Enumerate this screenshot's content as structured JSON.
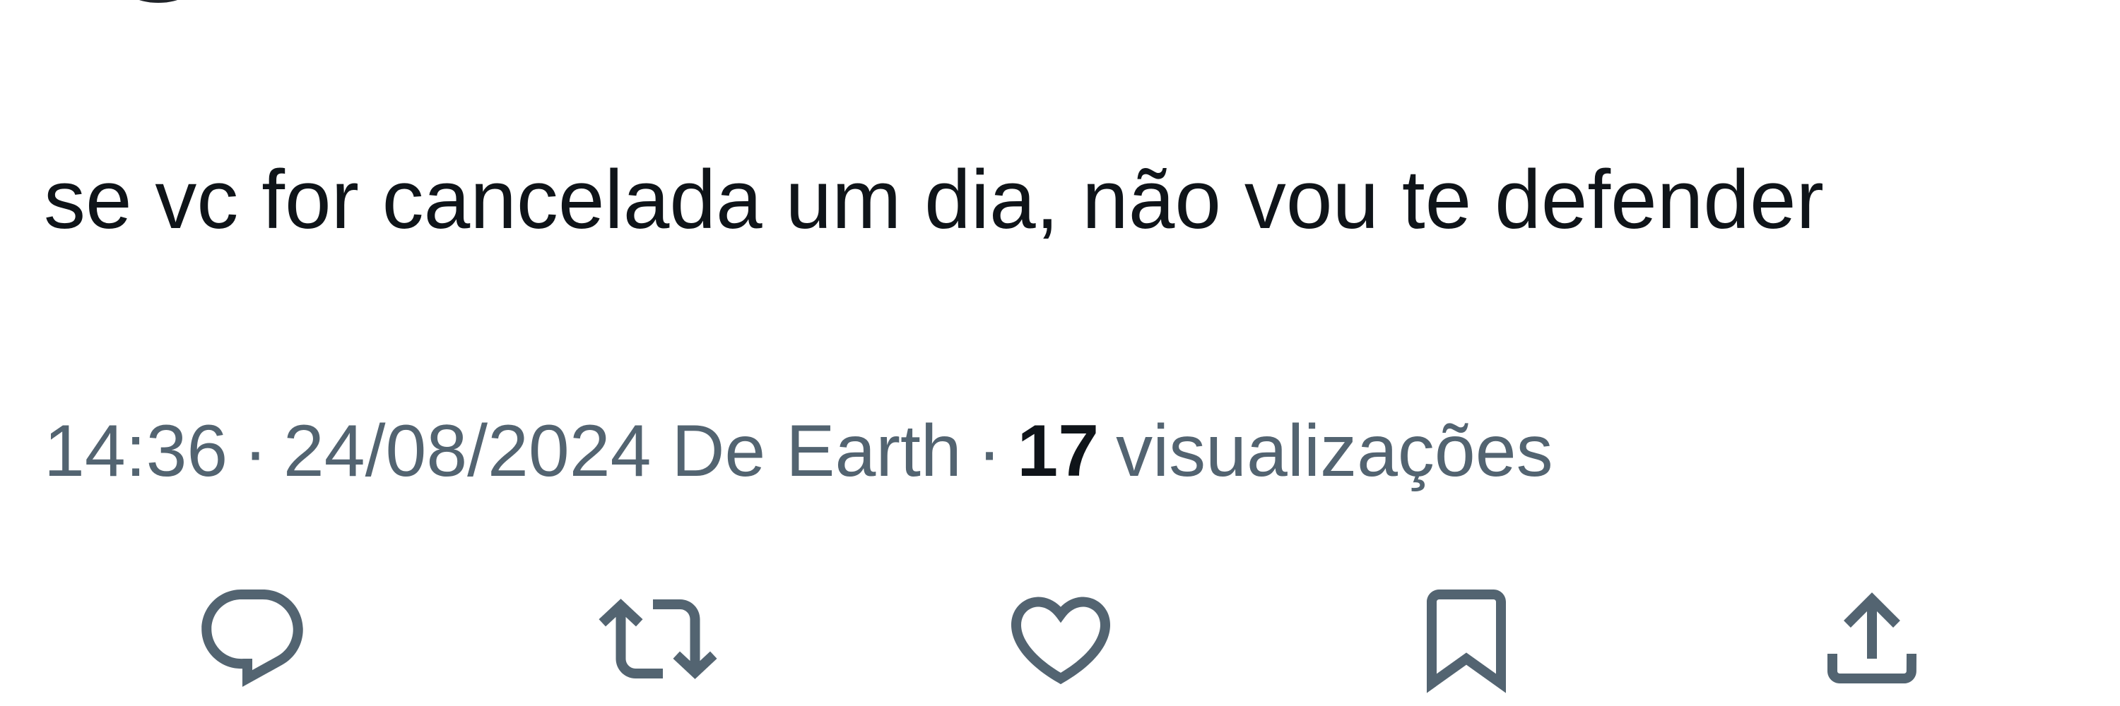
{
  "tweet": {
    "text": "se vc for cancelada um dia, não vou te defender"
  },
  "meta": {
    "time": "14:36",
    "separator_1": "·",
    "date": "24/08/2024",
    "source": "De Earth",
    "separator_2": "·",
    "views_count": "17",
    "views_label": "visualizações"
  },
  "actions": {
    "reply_icon": "reply-icon",
    "retweet_icon": "retweet-icon",
    "like_icon": "heart-icon",
    "bookmark_icon": "bookmark-icon",
    "share_icon": "share-icon"
  },
  "colors": {
    "text_primary": "#0f1419",
    "text_secondary": "#536471",
    "background": "#ffffff"
  }
}
